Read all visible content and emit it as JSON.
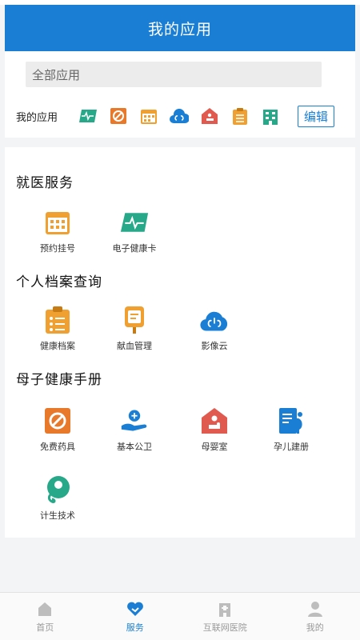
{
  "header": {
    "title": "我的应用"
  },
  "search": {
    "placeholder": "全部应用"
  },
  "my_apps": {
    "label": "我的应用",
    "icons": [
      "health-card-icon",
      "pills-icon",
      "calendar-icon",
      "lungs-cloud-icon",
      "mother-baby-icon",
      "clipboard-icon",
      "hospital-building-icon"
    ],
    "edit_label": "编辑"
  },
  "sections": [
    {
      "title": "就医服务",
      "apps": [
        {
          "label": "预约挂号",
          "icon": "calendar-icon"
        },
        {
          "label": "电子健康卡",
          "icon": "health-card-icon"
        }
      ]
    },
    {
      "title": "个人档案查询",
      "apps": [
        {
          "label": "健康档案",
          "icon": "clipboard-icon"
        },
        {
          "label": "献血管理",
          "icon": "blood-bag-icon"
        },
        {
          "label": "影像云",
          "icon": "lungs-cloud-icon"
        }
      ]
    },
    {
      "title": "母子健康手册",
      "apps": [
        {
          "label": "免费药具",
          "icon": "pills-icon"
        },
        {
          "label": "基本公卫",
          "icon": "hand-care-icon"
        },
        {
          "label": "母婴室",
          "icon": "mother-baby-icon"
        },
        {
          "label": "孕儿建册",
          "icon": "pregnancy-book-icon"
        },
        {
          "label": "计生技术",
          "icon": "family-planning-icon"
        }
      ]
    }
  ],
  "tabbar": {
    "items": [
      {
        "label": "首页",
        "icon": "home-icon",
        "active": false
      },
      {
        "label": "服务",
        "icon": "heart-service-icon",
        "active": true
      },
      {
        "label": "互联网医院",
        "icon": "hospital-icon",
        "active": false
      },
      {
        "label": "我的",
        "icon": "user-icon",
        "active": false
      }
    ]
  },
  "colors": {
    "brand": "#1a7fd4",
    "orange": "#f0a030",
    "green": "#27a889",
    "red": "#e05a4f"
  }
}
